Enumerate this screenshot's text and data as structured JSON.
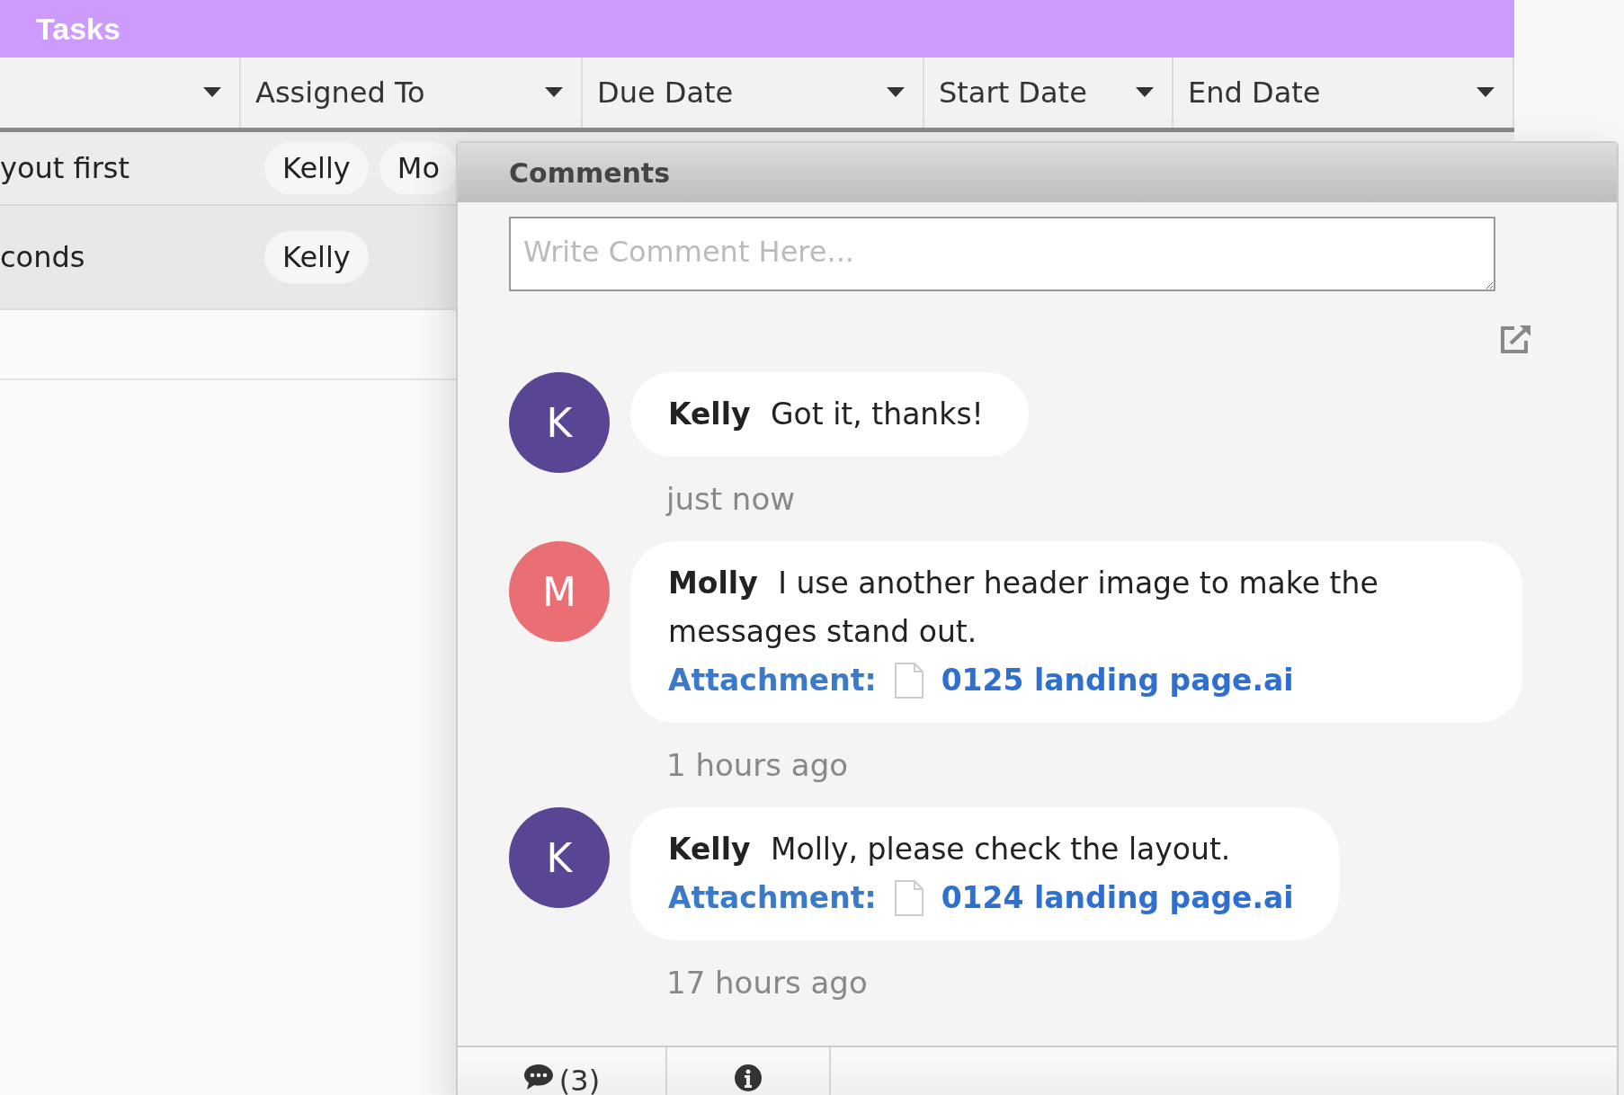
{
  "header": {
    "title": "Tasks"
  },
  "table": {
    "columns": [
      "Assigned To",
      "Due Date",
      "Start Date",
      "End Date"
    ],
    "rows": [
      {
        "column_1": "yout first",
        "assigned": [
          "Kelly",
          "Mo"
        ]
      },
      {
        "column_1": "conds",
        "assigned": [
          "Kelly"
        ]
      }
    ]
  },
  "comments_panel": {
    "title": "Comments",
    "placeholder": "Write Comment Here...",
    "comments": [
      {
        "initial": "K",
        "color": "#5a4594",
        "author": "Kelly",
        "text": "Got it, thanks!",
        "time": "just now"
      },
      {
        "initial": "M",
        "color": "#ea6f75",
        "author": "Molly",
        "text": "I use another header image to make the messages stand out.",
        "attachment": {
          "label": "Attachment:",
          "file": "0125 landing page.ai"
        },
        "time": "1 hours ago"
      },
      {
        "initial": "K",
        "color": "#5a4594",
        "author": "Kelly",
        "text": "Molly, please check the layout.",
        "attachment": {
          "label": "Attachment:",
          "file": "0124 landing page.ai"
        },
        "time": "17 hours ago"
      }
    ],
    "tabs": [
      {
        "kind": "comments",
        "label": "(3)"
      },
      {
        "kind": "info"
      }
    ]
  }
}
